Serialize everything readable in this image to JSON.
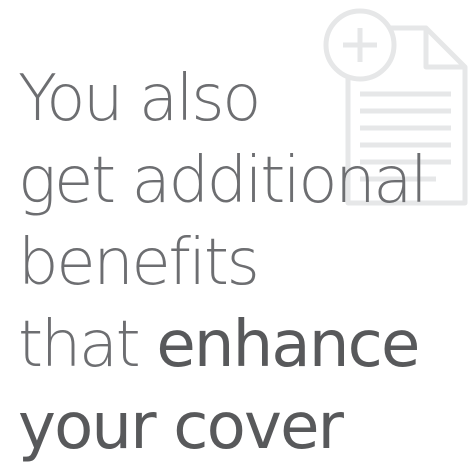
{
  "headline": {
    "line1": "You also",
    "line2": "get additional",
    "line3": "benefits",
    "line4_regular": "that ",
    "line4_bold": "enhance",
    "line5_bold": "your cover"
  },
  "colors": {
    "text": "#6d6e71",
    "text_bold": "#58595b",
    "icon": "#e6e7e8"
  },
  "icons": {
    "document": "document-add-icon"
  }
}
